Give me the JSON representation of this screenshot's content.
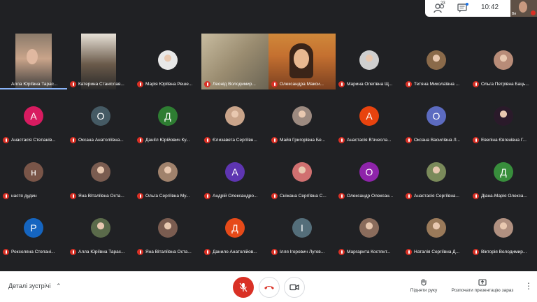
{
  "topbar": {
    "people_count": "23",
    "time": "10:42",
    "self_label": "Ви",
    "icons": [
      "people-icon",
      "chat-icon"
    ]
  },
  "participants": [
    {
      "name": "Алла Юріївна Тарас...",
      "type": "video",
      "speaking": true
    },
    {
      "name": "Катерина Станіслав...",
      "type": "video"
    },
    {
      "name": "Марія Юріївна Реше...",
      "type": "photo",
      "color": "#e8e8e8"
    },
    {
      "name": "Леонід Володимир...",
      "type": "video"
    },
    {
      "name": "Олександра Макси...",
      "type": "video"
    },
    {
      "name": "Марина Олегівна Щ...",
      "type": "photo",
      "color": "#cfcfcf"
    },
    {
      "name": "Тетяна Миколаївна ...",
      "type": "photo",
      "color": "#8a6a4a"
    },
    {
      "name": "Ольга Петрівна Баць...",
      "type": "photo",
      "color": "#b88c78"
    },
    {
      "name": "Анастасія Степанів...",
      "type": "letter",
      "letter": "A",
      "color": "#d81b60"
    },
    {
      "name": "Оксана Анатоліївна...",
      "type": "letter",
      "letter": "O",
      "color": "#455a64"
    },
    {
      "name": "Даніїл Юрійович Ку...",
      "type": "letter",
      "letter": "Д",
      "color": "#2e7d32"
    },
    {
      "name": "Єлизавета Сергіївн...",
      "type": "photo",
      "color": "#c9a48a"
    },
    {
      "name": "Майя Григорівна Бе...",
      "type": "photo",
      "color": "#9c8a80"
    },
    {
      "name": "Анастасія В'ячесла...",
      "type": "letter",
      "letter": "A",
      "color": "#e8430e"
    },
    {
      "name": "Оксана Василівна Л...",
      "type": "letter",
      "letter": "O",
      "color": "#5c6bc0"
    },
    {
      "name": "Евеліна Євгенівна Г...",
      "type": "photo",
      "color": "#2a1a2a"
    },
    {
      "name": "настя дудин",
      "type": "letter",
      "letter": "н",
      "color": "#795548"
    },
    {
      "name": "Яна Віталіївна Оста...",
      "type": "photo",
      "color": "#7a5c50"
    },
    {
      "name": "Ольга Сергіївна Му...",
      "type": "photo",
      "color": "#a0826c"
    },
    {
      "name": "Андрій Олександро...",
      "type": "letter",
      "letter": "A",
      "color": "#5e35b1"
    },
    {
      "name": "Сніжана Сергіївна С...",
      "type": "photo",
      "color": "#d07070"
    },
    {
      "name": "Олександр Олексан...",
      "type": "letter",
      "letter": "O",
      "color": "#8e24aa"
    },
    {
      "name": "Анастасія Сергіївна...",
      "type": "photo",
      "color": "#7a8a5a"
    },
    {
      "name": "Діана-Марія Олекса...",
      "type": "letter",
      "letter": "Д",
      "color": "#388e3c"
    },
    {
      "name": "Роксоляна Степані...",
      "type": "letter",
      "letter": "P",
      "color": "#1565c0"
    },
    {
      "name": "Алла Юріївна Тарас...",
      "type": "photo",
      "color": "#5a6a4a"
    },
    {
      "name": "Яна Віталіївна Оста...",
      "type": "photo",
      "color": "#7a5c50"
    },
    {
      "name": "Данило Анатолійов...",
      "type": "letter",
      "letter": "Д",
      "color": "#e64a19"
    },
    {
      "name": "Ілля Ігорович Лугов...",
      "type": "letter",
      "letter": "І",
      "color": "#546e7a"
    },
    {
      "name": "Маргарита Костянт...",
      "type": "photo",
      "color": "#8a6c5c"
    },
    {
      "name": "Наталія Сергіївна Д...",
      "type": "photo",
      "color": "#9a7a5a"
    },
    {
      "name": "Вікторія Володимир...",
      "type": "photo",
      "color": "#b09080"
    }
  ],
  "bottombar": {
    "details_label": "Деталі зустрічі",
    "raise_hand_label": "Підняти руку",
    "present_label": "Розпочати презентацію зараз"
  },
  "colors": {
    "background": "#202124",
    "mic_off": "#d93025",
    "speaking": "#8ab4f8"
  }
}
